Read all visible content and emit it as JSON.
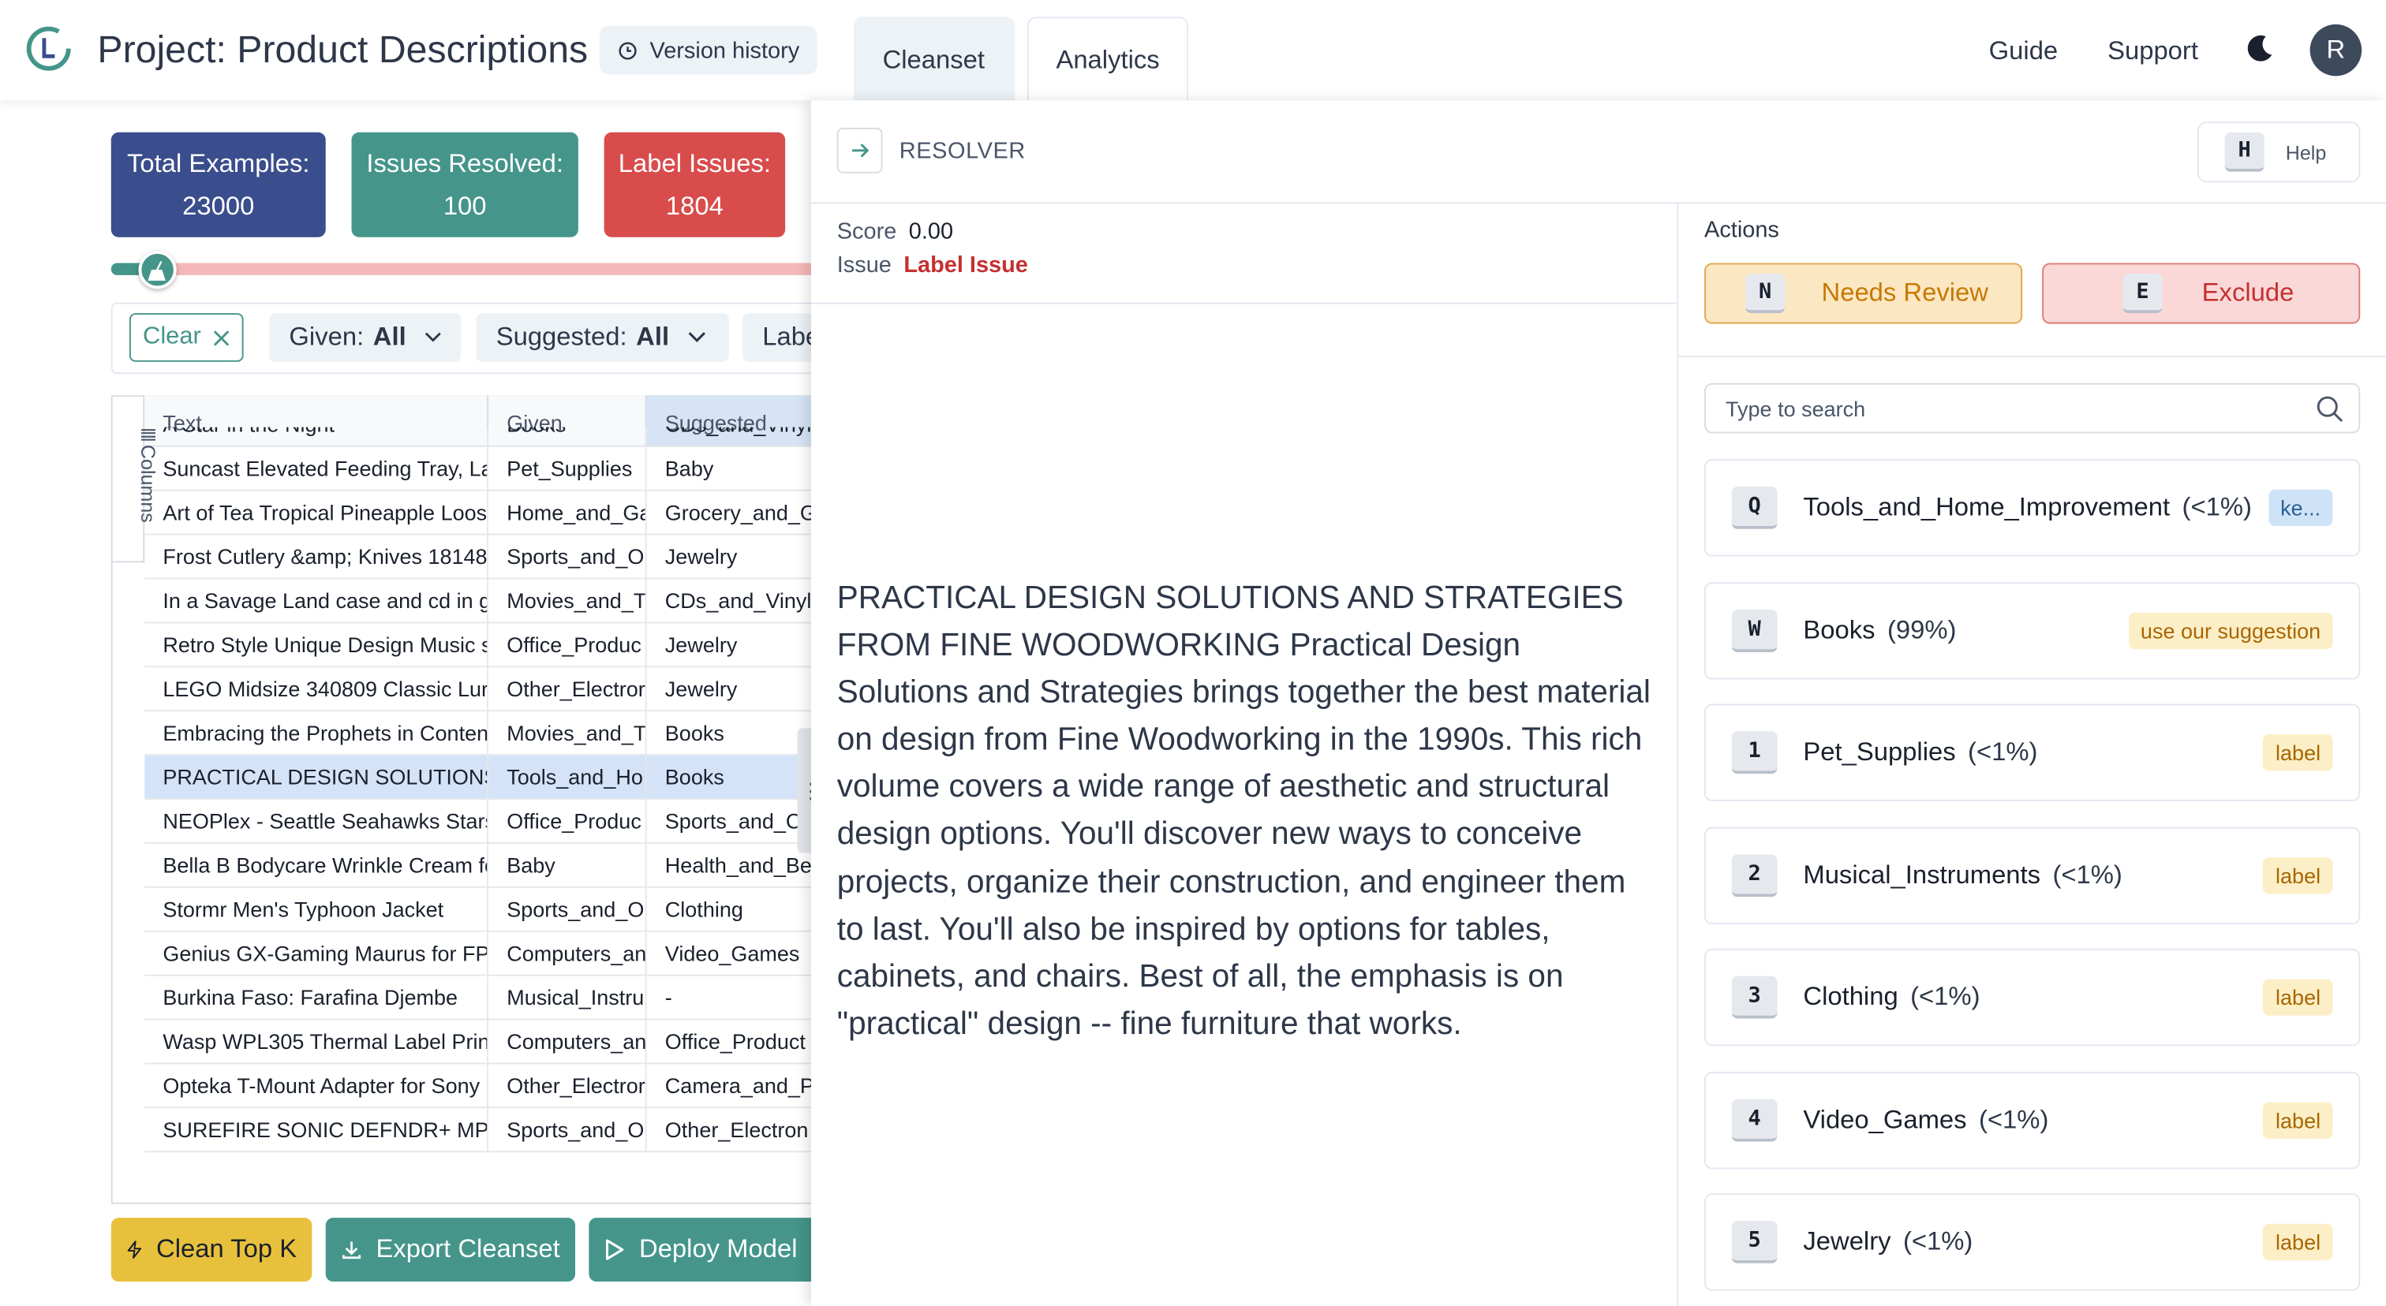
{
  "header": {
    "project_title": "Project: Product Descriptions",
    "version_history": "Version history",
    "tabs": [
      "Cleanset",
      "Analytics"
    ],
    "guide": "Guide",
    "support": "Support",
    "avatar_letter": "R"
  },
  "stats": {
    "total_label": "Total Examples:",
    "total_value": "23000",
    "resolved_label": "Issues Resolved:",
    "resolved_value": "100",
    "label_issues_label": "Label Issues:",
    "label_issues_value": "1804",
    "progress_fraction": 0.055
  },
  "filters": {
    "clear": "Clear",
    "given_label": "Given:",
    "given_value": "All",
    "suggested_label": "Suggested:",
    "suggested_value": "All",
    "label_partial": "Labe"
  },
  "table": {
    "columns_toggle": "Columns",
    "headers": [
      "Text",
      "Given",
      "Suggested"
    ],
    "rows": [
      [
        "A Star in the Night",
        "Books",
        "CDs_and_Vinyl"
      ],
      [
        "Suncast Elevated Feeding Tray, La",
        "Pet_Supplies",
        "Baby"
      ],
      [
        "Art of Tea Tropical Pineapple Loos",
        "Home_and_Ga",
        "Grocery_and_G"
      ],
      [
        "Frost Cutlery &amp; Knives 18148",
        "Sports_and_O",
        "Jewelry"
      ],
      [
        "In a Savage Land case and cd in g",
        "Movies_and_T",
        "CDs_and_Vinyl"
      ],
      [
        "Retro Style Unique Design Music s",
        "Office_Produc",
        "Jewelry"
      ],
      [
        "LEGO Midsize 340809 Classic Lur",
        "Other_Electror",
        "Jewelry"
      ],
      [
        "Embracing the Prophets in Conten",
        "Movies_and_T",
        "Books"
      ],
      [
        "PRACTICAL DESIGN SOLUTIONS /",
        "Tools_and_Ho",
        "Books"
      ],
      [
        "NEOPlex - Seattle Seahawks Stars",
        "Office_Produc",
        "Sports_and_C"
      ],
      [
        "Bella B Bodycare Wrinkle Cream fo",
        "Baby",
        "Health_and_Be"
      ],
      [
        "Stormr Men's Typhoon Jacket",
        "Sports_and_O",
        "Clothing"
      ],
      [
        "Genius GX-Gaming Maurus for FPS",
        "Computers_an",
        "Video_Games"
      ],
      [
        "Burkina Faso: Farafina Djembe",
        "Musical_Instru",
        "-"
      ],
      [
        "Wasp WPL305 Thermal Label Prin",
        "Computers_an",
        "Office_Product"
      ],
      [
        "Opteka T-Mount Adapter for Sony",
        "Other_Electror",
        "Camera_and_P"
      ],
      [
        "SUREFIRE SONIC DEFNDR+ MP PL",
        "Sports_and_O",
        "Other_Electron"
      ]
    ],
    "selected_index": 8
  },
  "bottom_buttons": {
    "clean": "Clean Top K",
    "export": "Export Cleanset",
    "deploy": "Deploy Model"
  },
  "resolver": {
    "title": "RESOLVER",
    "help_key": "H",
    "help_label": "Help",
    "score_label": "Score",
    "score_value": "0.00",
    "issue_label": "Issue",
    "issue_value": "Label Issue",
    "description": "PRACTICAL DESIGN SOLUTIONS AND STRATEGIES FROM FINE WOODWORKING Practical Design Solutions and Strategies brings together the best material on design from Fine Woodworking in the 1990s. This rich volume covers a wide range of aesthetic and structural design options. You'll discover new ways to conceive projects, organize their construction, and engineer them to last. You'll also be inspired by options for tables, cabinets, and chairs. Best of all, the emphasis is on \"practical\" design -- fine furniture that works.",
    "actions_title": "Actions",
    "needs_review_key": "N",
    "needs_review": "Needs Review",
    "exclude_key": "E",
    "exclude": "Exclude",
    "search_placeholder": "Type to search",
    "options": [
      {
        "key": "Q",
        "label": "Tools_and_Home_Improvement",
        "pct": "(<1%)",
        "tag": "ke...",
        "tag_style": "blue"
      },
      {
        "key": "W",
        "label": "Books",
        "pct": "(99%)",
        "tag": "use our suggestion",
        "tag_style": "yellow"
      },
      {
        "key": "1",
        "label": "Pet_Supplies",
        "pct": "(<1%)",
        "tag": "label",
        "tag_style": "yellow"
      },
      {
        "key": "2",
        "label": "Musical_Instruments",
        "pct": "(<1%)",
        "tag": "label",
        "tag_style": "yellow"
      },
      {
        "key": "3",
        "label": "Clothing",
        "pct": "(<1%)",
        "tag": "label",
        "tag_style": "yellow"
      },
      {
        "key": "4",
        "label": "Video_Games",
        "pct": "(<1%)",
        "tag": "label",
        "tag_style": "yellow"
      },
      {
        "key": "5",
        "label": "Jewelry",
        "pct": "(<1%)",
        "tag": "label",
        "tag_style": "yellow"
      }
    ]
  },
  "colors": {
    "teal": "#45958a",
    "navy": "#3a4d8c",
    "red": "#d94c4c",
    "yellow": "#e8c13c"
  }
}
